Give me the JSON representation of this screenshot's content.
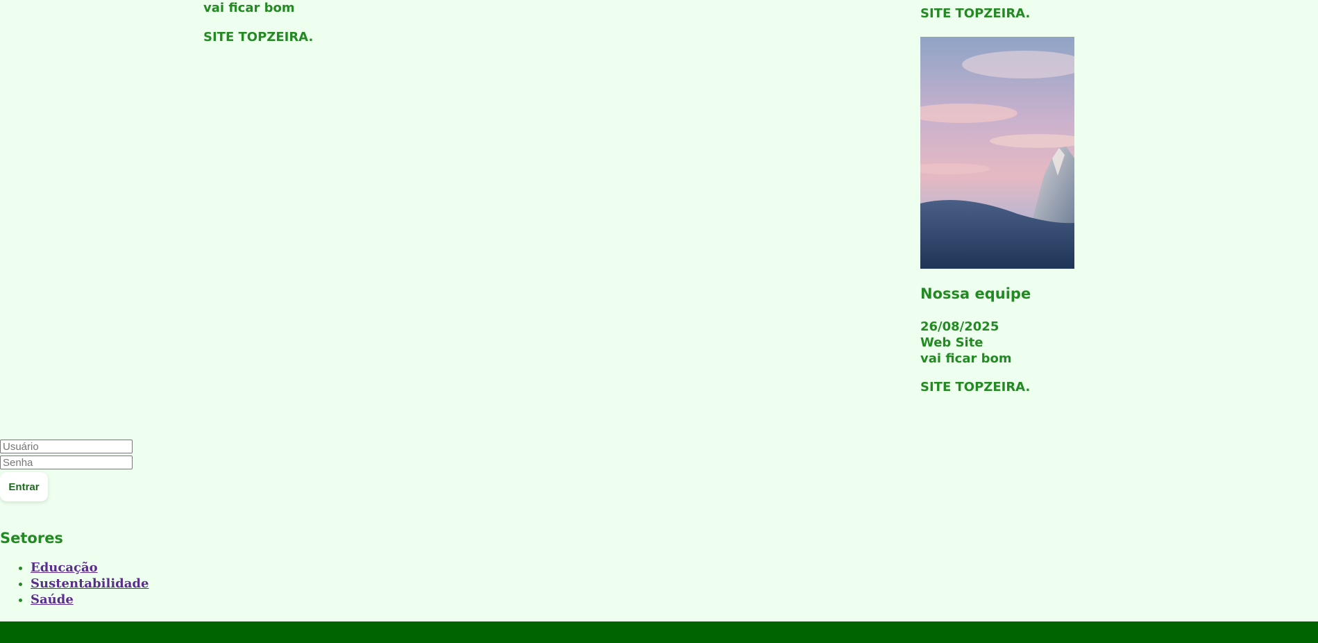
{
  "post_left": {
    "line_a": "vai ficar bom",
    "line_b": "SITE TOPZEIRA."
  },
  "post_right": {
    "top_text": "SITE TOPZEIRA.",
    "image_alt": "mountain-sunset-photo",
    "heading": "Nossa equipe",
    "date": "26/08/2025",
    "category": "Web Site",
    "line": "vai ficar bom",
    "bottom_text": "SITE TOPZEIRA."
  },
  "login": {
    "user_placeholder": "Usuário",
    "pass_placeholder": "Senha",
    "submit_label": "Entrar"
  },
  "setores": {
    "title": "Setores",
    "items": [
      {
        "label": "Educação"
      },
      {
        "label": "Sustentabilidade"
      },
      {
        "label": "Saúde"
      }
    ]
  },
  "colors": {
    "background": "#efffef",
    "text_green": "#238a23",
    "footer": "#006400",
    "link": "#5b2d8e"
  }
}
